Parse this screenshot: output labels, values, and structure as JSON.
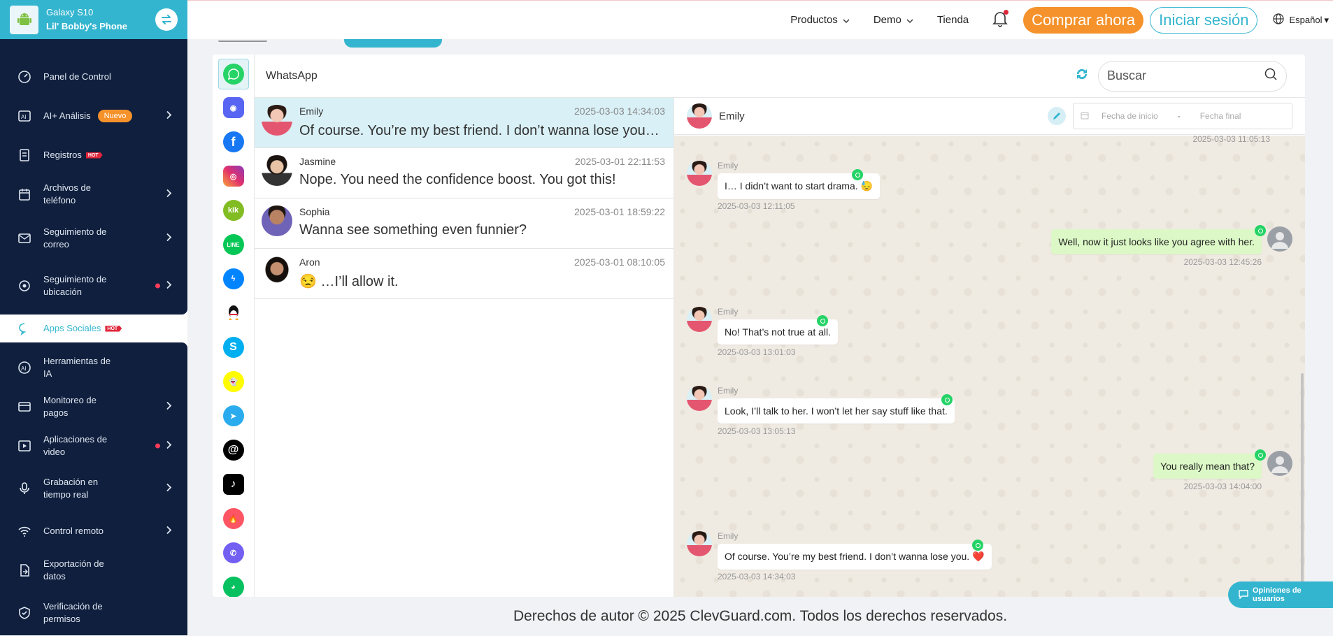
{
  "device": {
    "model": "Galaxy S10",
    "name": "Lil' Bobby's Phone"
  },
  "sidebar": {
    "items": [
      {
        "label": "Panel de Control"
      },
      {
        "label": "AI+ Análisis",
        "badge": "Nuevo"
      },
      {
        "label": "Registros",
        "hot": "HOT"
      },
      {
        "label": "Archivos de teléfono"
      },
      {
        "label": "Seguimiento de correo"
      },
      {
        "label": "Seguimiento de ubicación"
      },
      {
        "label": "Apps Sociales",
        "hot": "HOT"
      },
      {
        "label": "Herramientas de IA"
      },
      {
        "label": "Monitoreo de pagos"
      },
      {
        "label": "Aplicaciones de video"
      },
      {
        "label": "Grabación en tiempo real"
      },
      {
        "label": "Control remoto"
      },
      {
        "label": "Exportación de datos"
      },
      {
        "label": "Verificación de permisos"
      }
    ]
  },
  "topbar": {
    "products": "Productos",
    "demo": "Demo",
    "store": "Tienda",
    "buy": "Comprar ahora",
    "login": "Iniciar sesión",
    "language": "Español"
  },
  "apps": [
    "whatsapp-icon",
    "discord-icon",
    "facebook-icon",
    "instagram-icon",
    "kik-icon",
    "line-icon",
    "messenger-icon",
    "qq-icon",
    "skype-icon",
    "snapchat-icon",
    "telegram-icon",
    "threads-icon",
    "tiktok-icon",
    "tinder-icon",
    "viber-icon",
    "wechat-icon"
  ],
  "panel": {
    "title": "WhatsApp",
    "search_placeholder": "Buscar"
  },
  "conversations": [
    {
      "name": "Emily",
      "time": "2025-03-03 14:34:03",
      "message": "Of course. You’re my best friend. I don’t wanna lose you. ❤️"
    },
    {
      "name": "Jasmine",
      "time": "2025-03-01 22:11:53",
      "message": "Nope. You need the confidence boost. You got this!"
    },
    {
      "name": "Sophia",
      "time": "2025-03-01 18:59:22",
      "message": "Wanna see something even funnier?"
    },
    {
      "name": "Aron",
      "time": "2025-03-01 08:10:05",
      "message": "😒 …I’ll allow it."
    }
  ],
  "chat": {
    "contact": "Emily",
    "date_start_placeholder": "Fecha de inicio",
    "date_sep": "-",
    "date_end_placeholder": "Fecha final",
    "top_timestamp": "2025-03-03 11:05:13",
    "messages": [
      {
        "sender": "Emily",
        "text": "I… I didn’t want to start drama. 😓",
        "time": "2025-03-03 12:11:05",
        "incoming": true
      },
      {
        "sender": "",
        "text": "Well, now it just looks like you agree with her.",
        "time": "2025-03-03 12:45:26",
        "incoming": false
      },
      {
        "sender": "Emily",
        "text": "No! That’s not true at all.",
        "time": "2025-03-03 13:01:03",
        "incoming": true
      },
      {
        "sender": "Emily",
        "text": "Look, I’ll talk to her. I won’t let her say stuff like that.",
        "time": "2025-03-03 13:05:13",
        "incoming": true
      },
      {
        "sender": "",
        "text": "You really mean that?",
        "time": "2025-03-03 14:04:00",
        "incoming": false
      },
      {
        "sender": "Emily",
        "text": "Of course. You’re my best friend. I don’t wanna lose you. ❤️",
        "time": "2025-03-03 14:34:03",
        "incoming": true
      }
    ]
  },
  "feedback": "Opiniones de usuarios",
  "footer": "Derechos de autor © 2025 ClevGuard.com. Todos los derechos reservados."
}
